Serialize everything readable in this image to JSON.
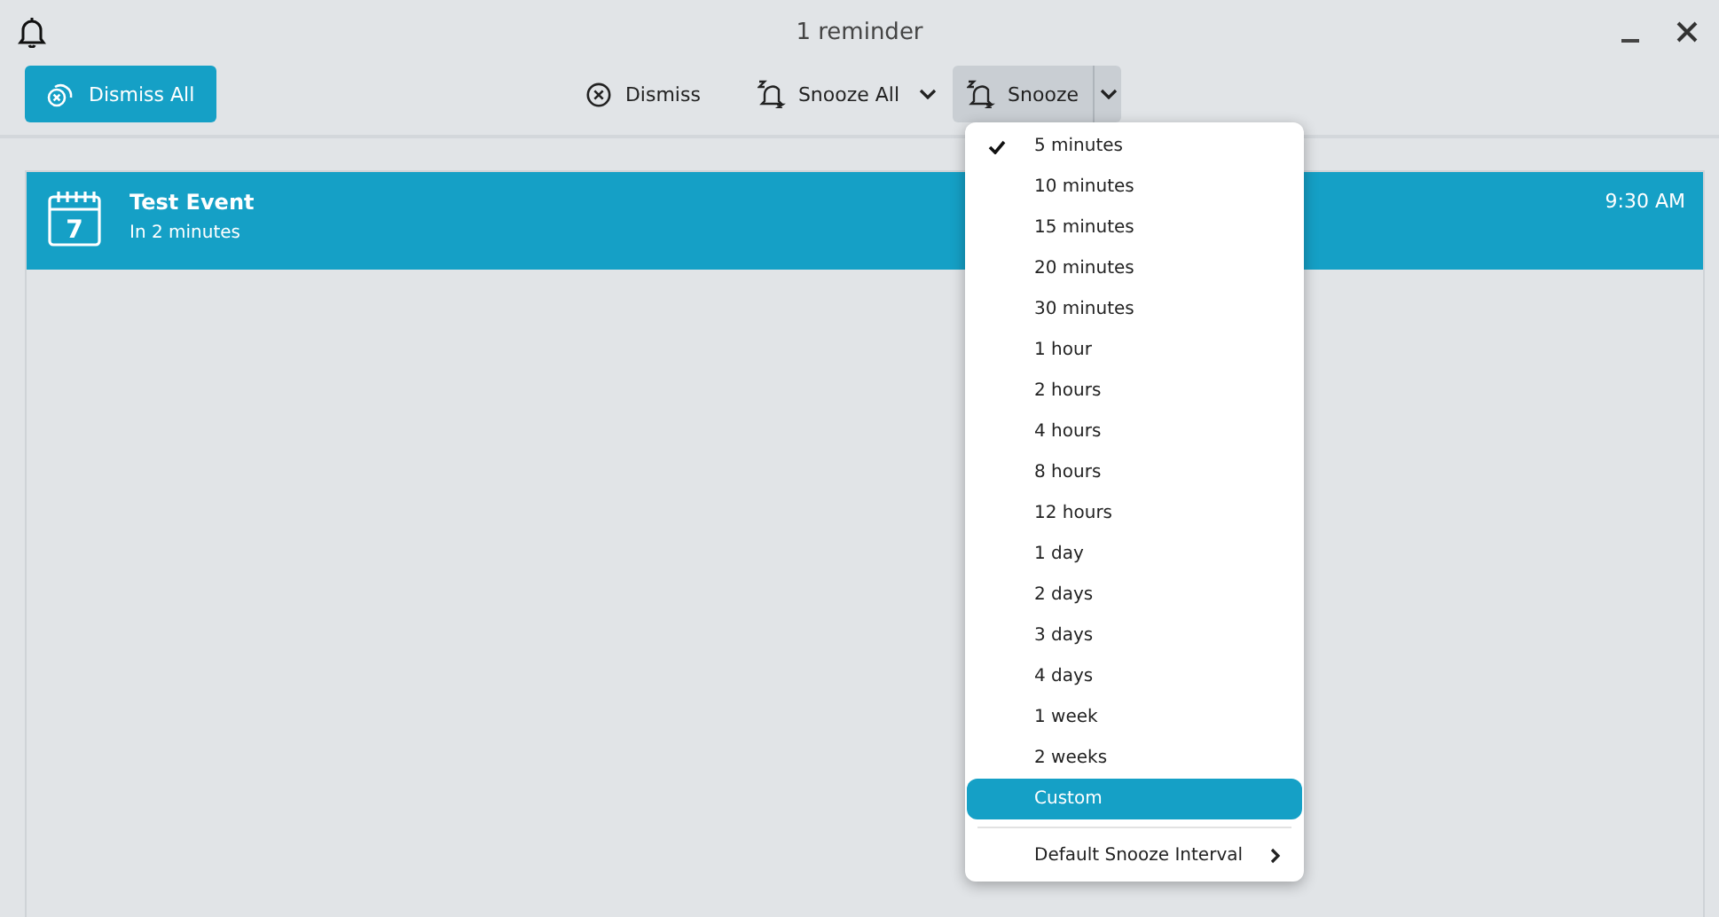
{
  "window": {
    "title": "1 reminder"
  },
  "toolbar": {
    "dismiss_all": "Dismiss All",
    "dismiss": "Dismiss",
    "snooze_all": "Snooze All",
    "snooze": "Snooze",
    "snooze_menu_open": true
  },
  "reminders": [
    {
      "title": "Test Event",
      "subtitle": "In 2 minutes",
      "time": "9:30 AM",
      "calendar_day": "7",
      "selected": true
    }
  ],
  "snooze_menu": [
    {
      "kind": "option",
      "label": "5 minutes",
      "checked": true,
      "selected": false
    },
    {
      "kind": "option",
      "label": "10 minutes",
      "checked": false,
      "selected": false
    },
    {
      "kind": "option",
      "label": "15 minutes",
      "checked": false,
      "selected": false
    },
    {
      "kind": "option",
      "label": "20 minutes",
      "checked": false,
      "selected": false
    },
    {
      "kind": "option",
      "label": "30 minutes",
      "checked": false,
      "selected": false
    },
    {
      "kind": "option",
      "label": "1 hour",
      "checked": false,
      "selected": false
    },
    {
      "kind": "option",
      "label": "2 hours",
      "checked": false,
      "selected": false
    },
    {
      "kind": "option",
      "label": "4 hours",
      "checked": false,
      "selected": false
    },
    {
      "kind": "option",
      "label": "8 hours",
      "checked": false,
      "selected": false
    },
    {
      "kind": "option",
      "label": "12 hours",
      "checked": false,
      "selected": false
    },
    {
      "kind": "option",
      "label": "1 day",
      "checked": false,
      "selected": false
    },
    {
      "kind": "option",
      "label": "2 days",
      "checked": false,
      "selected": false
    },
    {
      "kind": "option",
      "label": "3 days",
      "checked": false,
      "selected": false
    },
    {
      "kind": "option",
      "label": "4 days",
      "checked": false,
      "selected": false
    },
    {
      "kind": "option",
      "label": "1 week",
      "checked": false,
      "selected": false
    },
    {
      "kind": "option",
      "label": "2 weeks",
      "checked": false,
      "selected": false
    },
    {
      "kind": "option",
      "label": "Custom",
      "checked": false,
      "selected": true
    },
    {
      "kind": "submenu",
      "label": "Default Snooze Interval",
      "selected": false
    }
  ]
}
